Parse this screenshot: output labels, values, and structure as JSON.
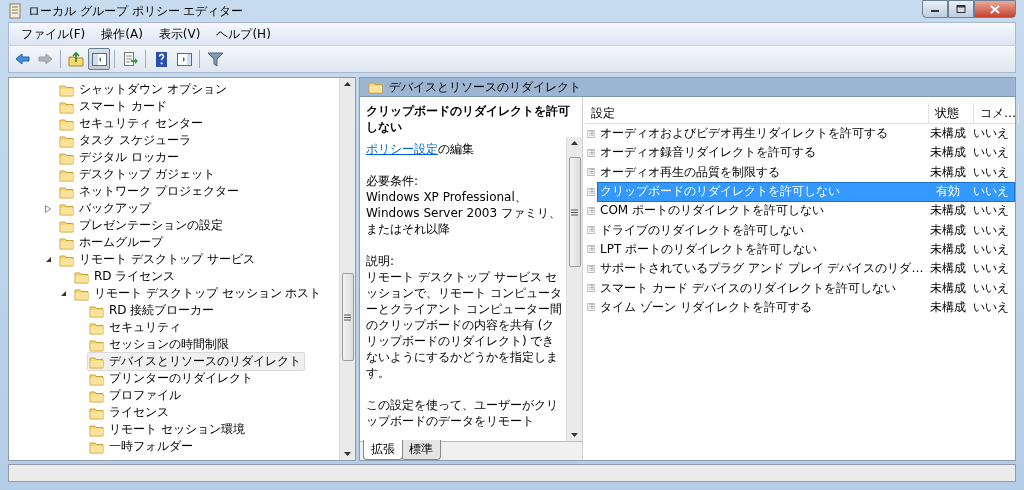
{
  "window": {
    "title": "ローカル グループ ポリシー エディター"
  },
  "menu": [
    {
      "label": "ファイル(F)"
    },
    {
      "label": "操作(A)"
    },
    {
      "label": "表示(V)"
    },
    {
      "label": "ヘルプ(H)"
    }
  ],
  "toolbar": [
    {
      "kind": "back",
      "disabled": false
    },
    {
      "kind": "forward",
      "disabled": true
    },
    {
      "kind": "sep"
    },
    {
      "kind": "up",
      "disabled": false
    },
    {
      "kind": "tree",
      "disabled": false,
      "pressed": true
    },
    {
      "kind": "sep"
    },
    {
      "kind": "export",
      "disabled": false
    },
    {
      "kind": "sep"
    },
    {
      "kind": "help",
      "disabled": false
    },
    {
      "kind": "panel",
      "disabled": false
    },
    {
      "kind": "sep"
    },
    {
      "kind": "filter",
      "disabled": false
    }
  ],
  "tree": {
    "items": [
      {
        "label": "シャットダウン オプション",
        "selected": false
      },
      {
        "label": "スマート カード",
        "selected": false
      },
      {
        "label": "セキュリティ センター",
        "selected": false
      },
      {
        "label": "タスク スケジューラ",
        "selected": false
      },
      {
        "label": "デジタル ロッカー",
        "selected": false
      },
      {
        "label": "デスクトップ ガジェット",
        "selected": false
      },
      {
        "label": "ネットワーク プロジェクター",
        "selected": false
      },
      {
        "label": "バックアップ",
        "selected": false,
        "expanded": false
      },
      {
        "label": "プレゼンテーションの設定",
        "selected": false
      },
      {
        "label": "ホームグループ",
        "selected": false
      },
      {
        "label": "リモート デスクトップ サービス",
        "selected": false,
        "expanded": true,
        "children": [
          {
            "label": "RD ライセンス",
            "selected": false
          },
          {
            "label": "リモート デスクトップ セッション ホスト",
            "selected": false,
            "expanded": true,
            "children": [
              {
                "label": "RD 接続ブローカー",
                "selected": false
              },
              {
                "label": "セキュリティ",
                "selected": false
              },
              {
                "label": "セッションの時間制限",
                "selected": false
              },
              {
                "label": "デバイスとリソースのリダイレクト",
                "selected": true
              },
              {
                "label": "プリンターのリダイレクト",
                "selected": false
              },
              {
                "label": "プロファイル",
                "selected": false
              },
              {
                "label": "ライセンス",
                "selected": false
              },
              {
                "label": "リモート セッション環境",
                "selected": false
              },
              {
                "label": "一時フォルダー",
                "selected": false
              }
            ]
          }
        ]
      }
    ]
  },
  "header": "デバイスとリソースのリダイレクト",
  "policy": {
    "title": "クリップボードのリダイレクトを許可しない",
    "link": "ポリシー設定",
    "link_suffix": "の編集",
    "sections": [
      {
        "heading": "必要条件:",
        "body": "Windows XP Professional、Windows Server 2003 ファミリ、またはそれ以降"
      },
      {
        "heading": "説明:",
        "body": "リモート デスクトップ サービス セッションで、リモート コンピューターとクライアント コンピューター間のクリップボードの内容を共有 (クリップボードのリダイレクト) できないようにするかどうかを指定します。"
      }
    ],
    "more": "この設定を使って、ユーザーがクリップボードのデータをリモート"
  },
  "tabs": [
    {
      "label": "拡張",
      "selected": true
    },
    {
      "label": "標準",
      "selected": false
    }
  ],
  "table": {
    "columns": [
      "設定",
      "状態",
      "コメ…"
    ],
    "rows": [
      {
        "setting": "オーディオおよびビデオ再生リダイレクトを許可する",
        "state": "未構成",
        "comment": "いいえ",
        "selected": false
      },
      {
        "setting": "オーディオ録音リダイレクトを許可する",
        "state": "未構成",
        "comment": "いいえ",
        "selected": false
      },
      {
        "setting": "オーディオ再生の品質を制限する",
        "state": "未構成",
        "comment": "いいえ",
        "selected": false
      },
      {
        "setting": "クリップボードのリダイレクトを許可しない",
        "state": "有効",
        "comment": "いいえ",
        "selected": true
      },
      {
        "setting": "COM ポートのリダイレクトを許可しない",
        "state": "未構成",
        "comment": "いいえ",
        "selected": false
      },
      {
        "setting": "ドライブのリダイレクトを許可しない",
        "state": "未構成",
        "comment": "いいえ",
        "selected": false
      },
      {
        "setting": "LPT ポートのリダイレクトを許可しない",
        "state": "未構成",
        "comment": "いいえ",
        "selected": false
      },
      {
        "setting": "サポートされているプラグ アンド プレイ デバイスのリダ…",
        "state": "未構成",
        "comment": "いいえ",
        "selected": false
      },
      {
        "setting": "スマート カード デバイスのリダイレクトを許可しない",
        "state": "未構成",
        "comment": "いいえ",
        "selected": false
      },
      {
        "setting": "タイム ゾーン リダイレクトを許可する",
        "state": "未構成",
        "comment": "いいえ",
        "selected": false
      }
    ]
  }
}
